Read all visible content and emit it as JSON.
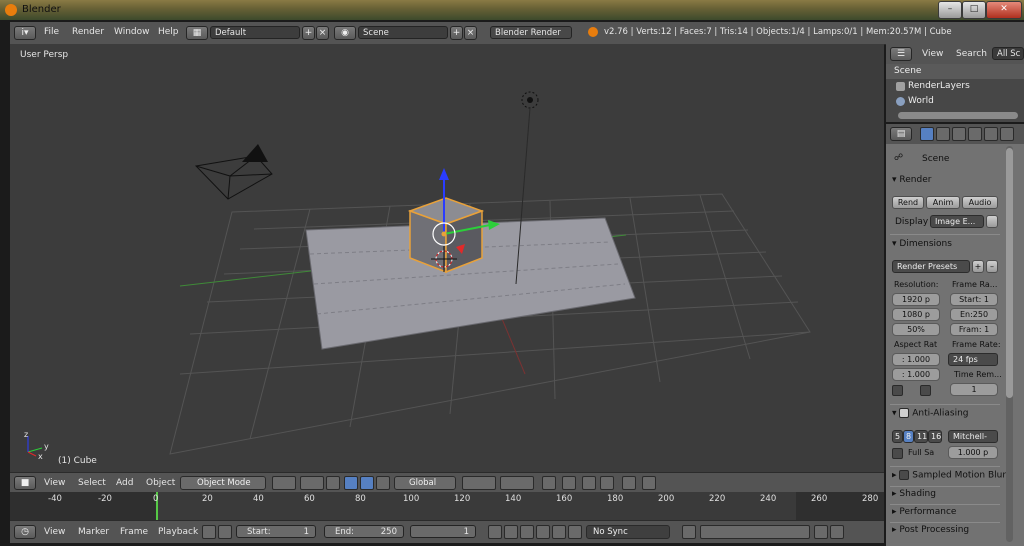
{
  "window": {
    "title": "Blender"
  },
  "info_header": {
    "menus": [
      "File",
      "Render",
      "Window",
      "Help"
    ],
    "layout_value": "Default",
    "scene_value": "Scene",
    "render_engine": "Blender Render",
    "stats": "v2.76 | Verts:12 | Faces:7 | Tris:14 | Objects:1/4 | Lamps:0/1 | Mem:20.57M | Cube"
  },
  "viewport": {
    "view_label": "User Persp",
    "object_label": "(1) Cube",
    "axis_x": "x",
    "axis_y": "y",
    "axis_z": "z"
  },
  "view3d_header": {
    "menus": [
      "View",
      "Select",
      "Add",
      "Object"
    ],
    "mode": "Object Mode",
    "orientation": "Global"
  },
  "timeline": {
    "ticks": [
      "-40",
      "-20",
      "0",
      "20",
      "40",
      "60",
      "80",
      "100",
      "120",
      "140",
      "160",
      "180",
      "200",
      "220",
      "240",
      "260",
      "280"
    ]
  },
  "timeline_header": {
    "menus": [
      "View",
      "Marker",
      "Frame",
      "Playback"
    ],
    "start_label": "Start:",
    "start_value": "1",
    "end_label": "End:",
    "end_value": "250",
    "current_frame": "1",
    "sync": "No Sync"
  },
  "outliner": {
    "menus": [
      "View",
      "Search"
    ],
    "filter": "All Sc",
    "items": [
      "Scene",
      "RenderLayers",
      "World"
    ]
  },
  "properties": {
    "context": "Scene",
    "render_section": "Render",
    "render_buttons": [
      "Rend",
      "Anim",
      "Audio"
    ],
    "display_label": "Display",
    "display_value": "Image E...",
    "dimensions_section": "Dimensions",
    "render_presets": "Render Presets",
    "resolution_label": "Resolution:",
    "res_x": "1920 p",
    "res_y": "1080 p",
    "res_pct": "50%",
    "frame_range_label": "Frame Ra...",
    "frame_start": "Start: 1",
    "frame_end": "En:250",
    "frame_step": "Fram: 1",
    "aspect_label": "Aspect Rat",
    "aspect_x": ": 1.000",
    "aspect_y": ": 1.000",
    "frame_rate_label": "Frame Rate:",
    "frame_rate": "24 fps",
    "time_remap_label": "Time Rem...",
    "time_remap_value": "1",
    "aa_section": "Anti-Aliasing",
    "aa_samples": [
      "5",
      "8",
      "11",
      "16"
    ],
    "aa_filter": "Mitchell-",
    "full_sample_label": "Full Sa",
    "filter_size": "1.000 p",
    "motion_blur_section": "Sampled Motion Blur",
    "shading_section": "Shading",
    "performance_section": "Performance",
    "post_processing_section": "Post Processing"
  }
}
